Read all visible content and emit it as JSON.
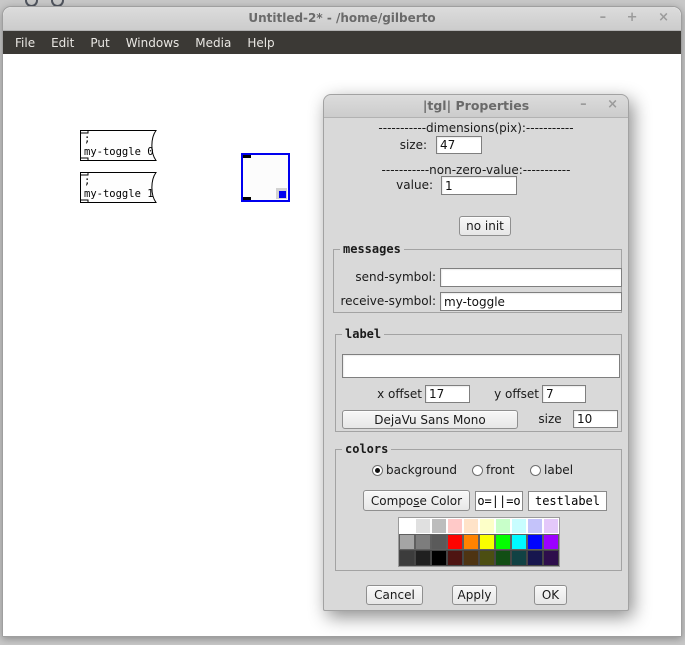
{
  "desktop": {
    "background": "#c8c8c8"
  },
  "main_window": {
    "title": "Untitled-2* - /home/gilberto",
    "controls": {
      "minimize": "–",
      "maximize": "+",
      "close": "×"
    },
    "menu": [
      "File",
      "Edit",
      "Put",
      "Windows",
      "Media",
      "Help"
    ],
    "canvas": {
      "message_boxes": [
        {
          "line1": ";",
          "line2": "my-toggle 0"
        },
        {
          "line1": ";",
          "line2": "my-toggle 1"
        }
      ],
      "toggle": {
        "selected_color": "#0000ee"
      }
    }
  },
  "dialog": {
    "title": "|tgl| Properties",
    "controls": {
      "minimize": "–",
      "close": "×"
    },
    "dimensions_header": "-----------dimensions(pix):-----------",
    "size_label": "size:",
    "size_value": "47",
    "nonzero_header": "-----------non-zero-value:-----------",
    "value_label": "value:",
    "value_value": "1",
    "no_init_button": "no init",
    "messages": {
      "legend": "messages",
      "send_label": "send-symbol:",
      "send_value": "",
      "receive_label": "receive-symbol:",
      "receive_value": "my-toggle"
    },
    "label_section": {
      "legend": "label",
      "label_value": "",
      "x_offset_label": "x offset",
      "x_offset_value": "17",
      "y_offset_label": "y offset",
      "y_offset_value": "7",
      "font_button": "DejaVu Sans Mono",
      "size_label": "size",
      "size_value": "10"
    },
    "colors_section": {
      "legend": "colors",
      "radios": [
        {
          "label": "background",
          "selected": true
        },
        {
          "label": "front",
          "selected": false
        },
        {
          "label": "label",
          "selected": false
        }
      ],
      "compose_button": {
        "pre": "Compo",
        "mnemonic": "s",
        "post": "e Color"
      },
      "toggle_preview": "o=||=o",
      "label_preview": "testlabel",
      "palette": [
        [
          "#ffffff",
          "#e0e0e0",
          "#bdbdbd",
          "#ffc9c8",
          "#ffe3c8",
          "#fdffc8",
          "#c8ffc9",
          "#c8fdff",
          "#c4c3fa",
          "#e4c8fa"
        ],
        [
          "#a5a5a5",
          "#7d7d7d",
          "#5a5a5a",
          "#ff0400",
          "#ff8300",
          "#f9ff00",
          "#04ff00",
          "#00f9ff",
          "#0004ff",
          "#9c00ff"
        ],
        [
          "#3c3c3c",
          "#202020",
          "#000000",
          "#4e1412",
          "#4e3412",
          "#4c4e12",
          "#124e14",
          "#114244",
          "#17164e",
          "#2e0e4c"
        ]
      ]
    },
    "action_buttons": {
      "cancel": "Cancel",
      "apply": "Apply",
      "ok": "OK"
    }
  }
}
